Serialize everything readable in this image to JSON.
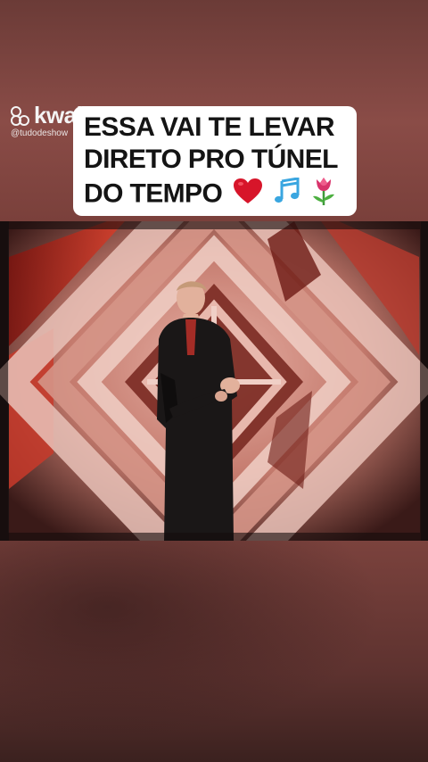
{
  "watermark": {
    "brand": "kwai",
    "handle": "@tudodeshow"
  },
  "caption": {
    "line1": "ESSA VAI TE LEVAR",
    "line2": "DIRETO PRO TÚNEL",
    "line3": "DO TEMPO",
    "emojis": [
      "heart-icon",
      "music-notes-icon",
      "tulip-icon"
    ]
  },
  "video": {
    "scene": "man-in-black-suit-on-red-diamond-stage"
  },
  "colors": {
    "background": "#6e3c38",
    "caption_bg": "#ffffff",
    "caption_text": "#141414",
    "heart": "#d7152a",
    "notes": "#3aa6e0",
    "tulip": "#d8336b"
  }
}
